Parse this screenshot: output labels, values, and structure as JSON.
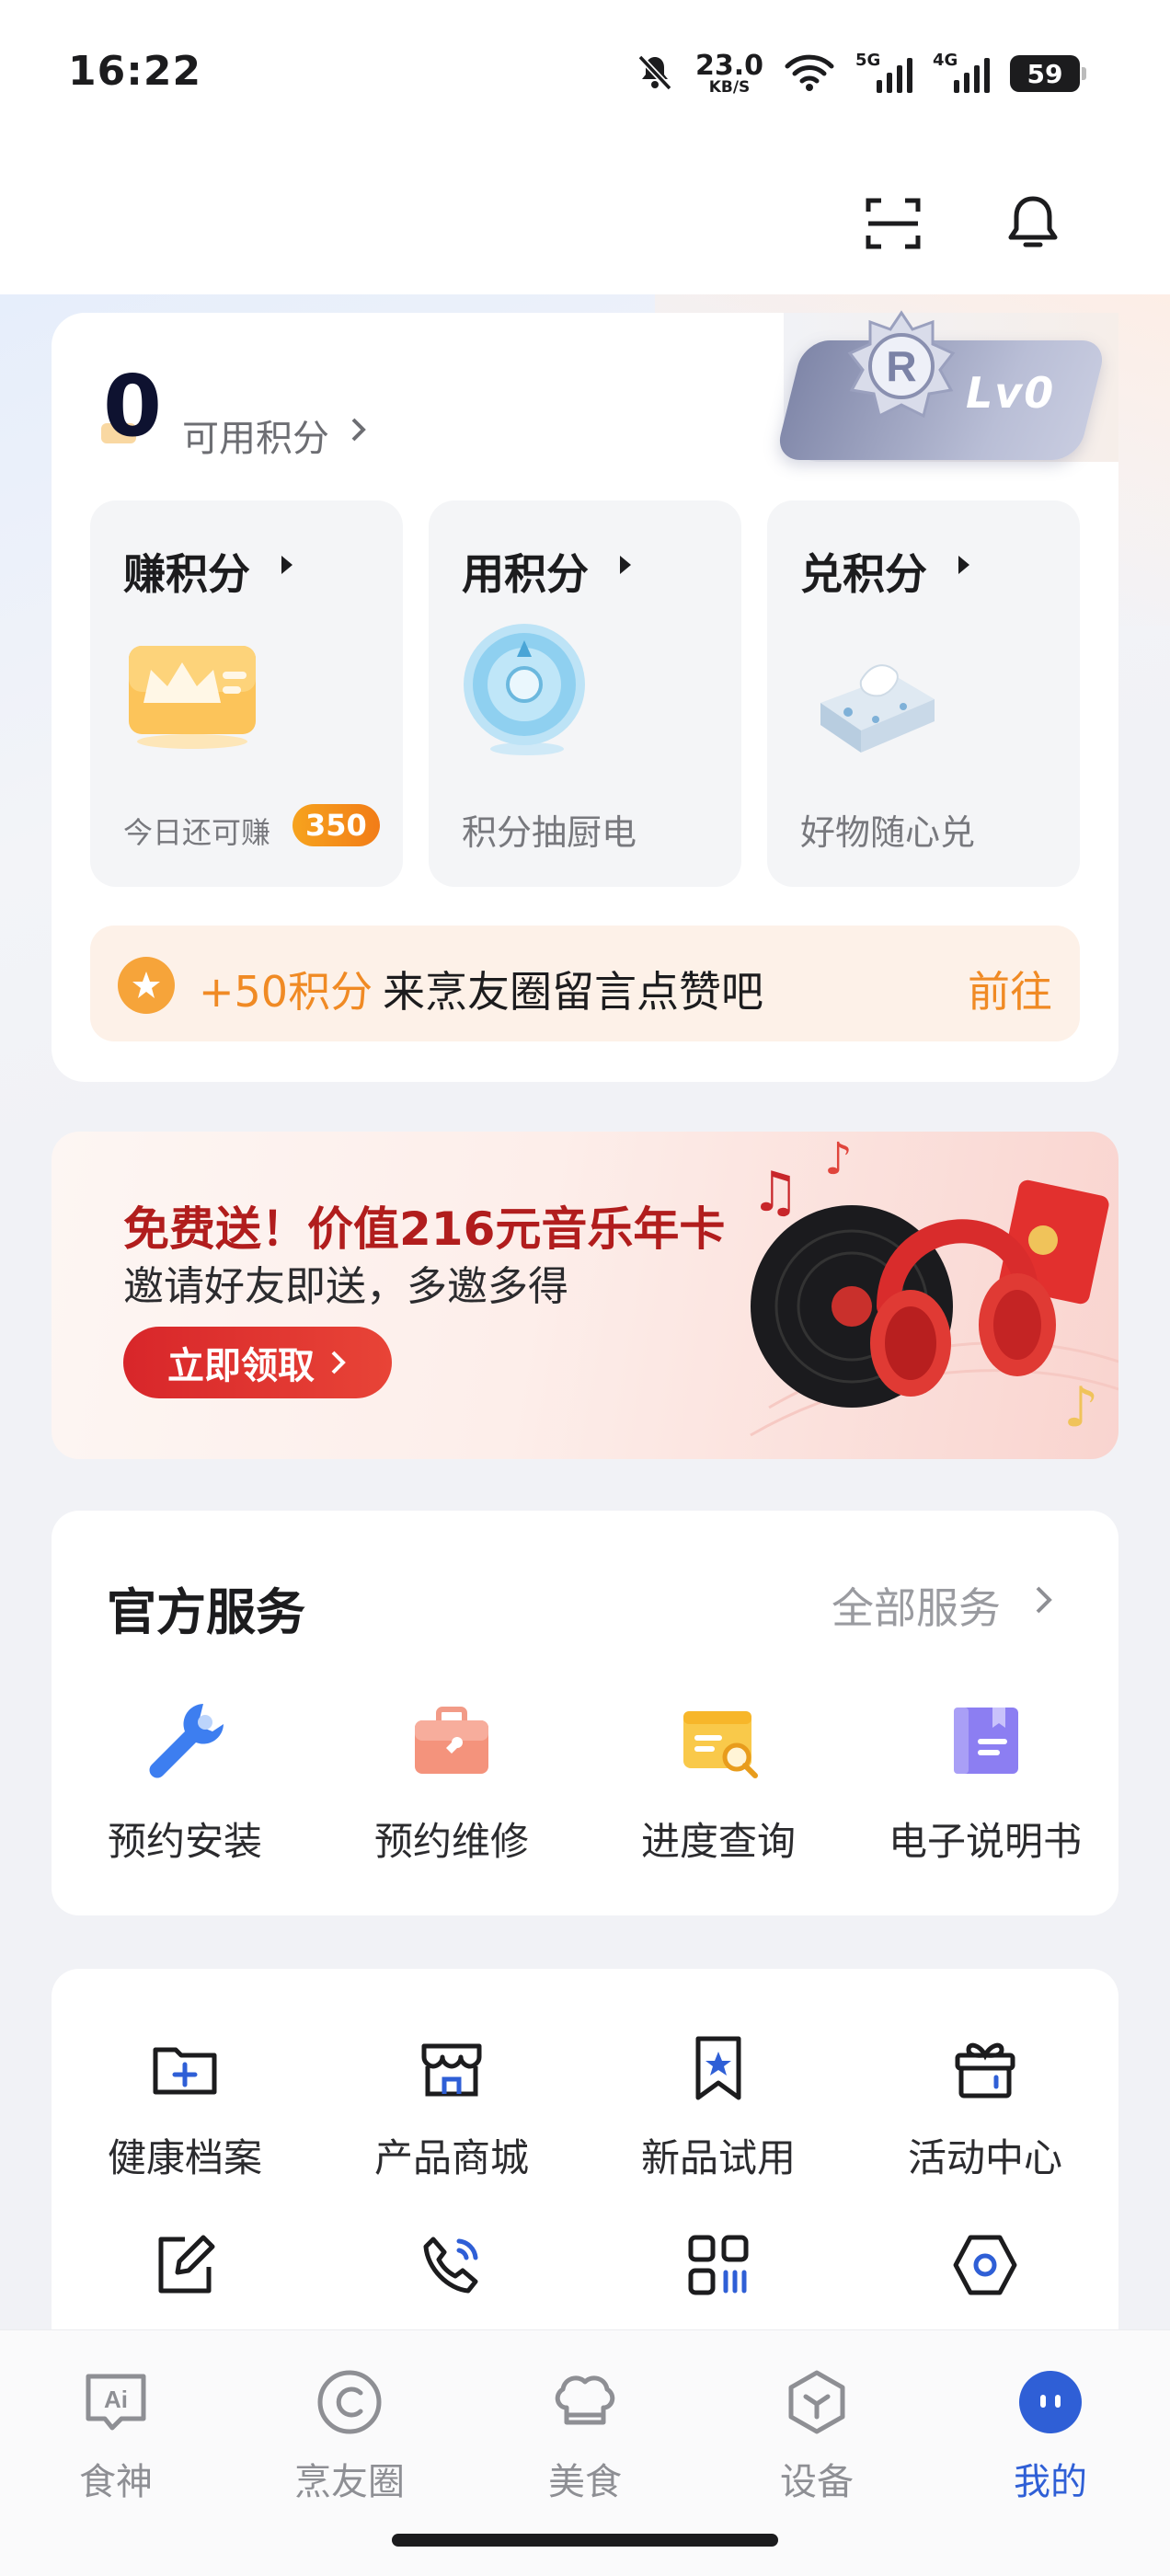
{
  "status_bar": {
    "time": "16:22",
    "net_speed_value": "23.0",
    "net_speed_unit": "KB/S",
    "signal1_tag": "5G",
    "signal2_tag": "4G",
    "battery": "59",
    "icons": [
      "mute-icon",
      "wifi-icon",
      "signal-5g-icon",
      "signal-4g-icon",
      "battery-icon"
    ]
  },
  "header": {
    "icons": [
      "scan-icon",
      "bell-icon"
    ]
  },
  "points": {
    "value": "0",
    "label": "可用积分",
    "level": "Lv0",
    "cards": [
      {
        "title": "赚积分",
        "desc_prefix": "今日还可赚",
        "badge": "350",
        "icon": "crown-card-icon"
      },
      {
        "title": "用积分",
        "desc": "积分抽厨电",
        "icon": "prize-wheel-icon"
      },
      {
        "title": "兑积分",
        "desc": "好物随心兑",
        "icon": "tissue-pack-icon"
      }
    ],
    "task": {
      "points": "+50积分",
      "text": "来烹友圈留言点赞吧",
      "action": "前往"
    }
  },
  "banner": {
    "title": "免费送！价值216元音乐年卡",
    "subtitle": "邀请好友即送，多邀多得",
    "cta": "立即领取"
  },
  "services": {
    "title": "官方服务",
    "all_label": "全部服务",
    "items": [
      {
        "label": "预约安装",
        "icon": "wrench-icon"
      },
      {
        "label": "预约维修",
        "icon": "toolbox-icon"
      },
      {
        "label": "进度查询",
        "icon": "search-doc-icon"
      },
      {
        "label": "电子说明书",
        "icon": "manual-icon"
      }
    ]
  },
  "tools": {
    "items": [
      {
        "label": "健康档案",
        "icon": "health-folder-icon"
      },
      {
        "label": "产品商城",
        "icon": "store-icon"
      },
      {
        "label": "新品试用",
        "icon": "bookmark-star-icon"
      },
      {
        "label": "活动中心",
        "icon": "gift-icon"
      }
    ],
    "second_row_icons": [
      "edit-icon",
      "phone-call-icon",
      "apps-grid-icon",
      "hex-settings-icon"
    ]
  },
  "tabbar": {
    "items": [
      {
        "label": "食神",
        "icon": "ai-icon"
      },
      {
        "label": "烹友圈",
        "icon": "community-icon"
      },
      {
        "label": "美食",
        "icon": "chef-hat-icon"
      },
      {
        "label": "设备",
        "icon": "device-icon"
      },
      {
        "label": "我的",
        "icon": "profile-icon",
        "active": true
      }
    ]
  },
  "colors": {
    "accent": "#2f5fd6",
    "orange": "#f08a24",
    "banner_red": "#d8262a"
  }
}
